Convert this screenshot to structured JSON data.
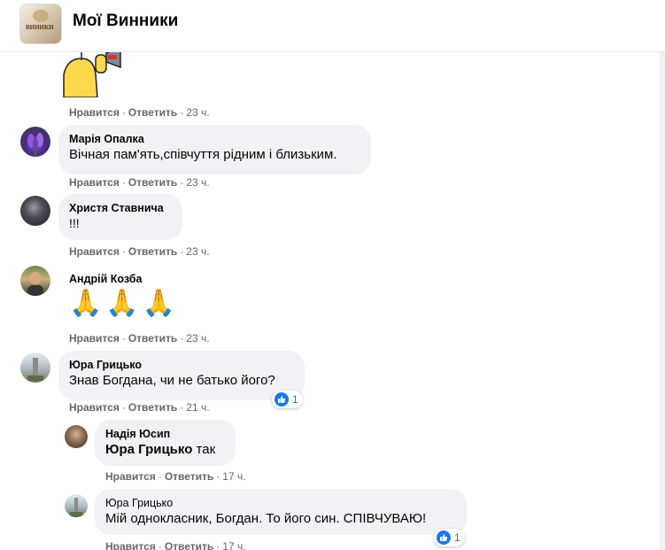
{
  "header": {
    "title": "Мої Винники",
    "avatar_text": "ВИНИКИ"
  },
  "actions": {
    "like": "Нравится",
    "reply": "Ответить",
    "separator": "·"
  },
  "comments": [
    {
      "time": "23 ч."
    },
    {
      "author": "Марія Опалка",
      "text": "Вічная пам'ять,співчуття рідним і близьким.",
      "time": "23 ч."
    },
    {
      "author": "Христя Ставнича",
      "text": "!!!",
      "time": "23 ч."
    },
    {
      "author": "Андрій Козба",
      "text": "🙏🙏🙏",
      "time": "23 ч."
    },
    {
      "author": "Юра Грицько",
      "text": "Знав Богдана, чи не батько його?",
      "time": "21 ч.",
      "reactions": "1"
    }
  ],
  "replies": [
    {
      "author": "Надія Юсип",
      "mention": "Юра Грицько",
      "text": " так",
      "time": "17 ч."
    },
    {
      "author": "Юра Грицько",
      "text": "Мій однокласник, Богдан. То його син. СПІВЧУВАЮ!",
      "time": "17 ч.",
      "reactions": "1"
    }
  ],
  "colors": {
    "like_blue": "#1877f2",
    "bubble_bg": "#f0f2f5",
    "meta_gray": "#65676b"
  }
}
